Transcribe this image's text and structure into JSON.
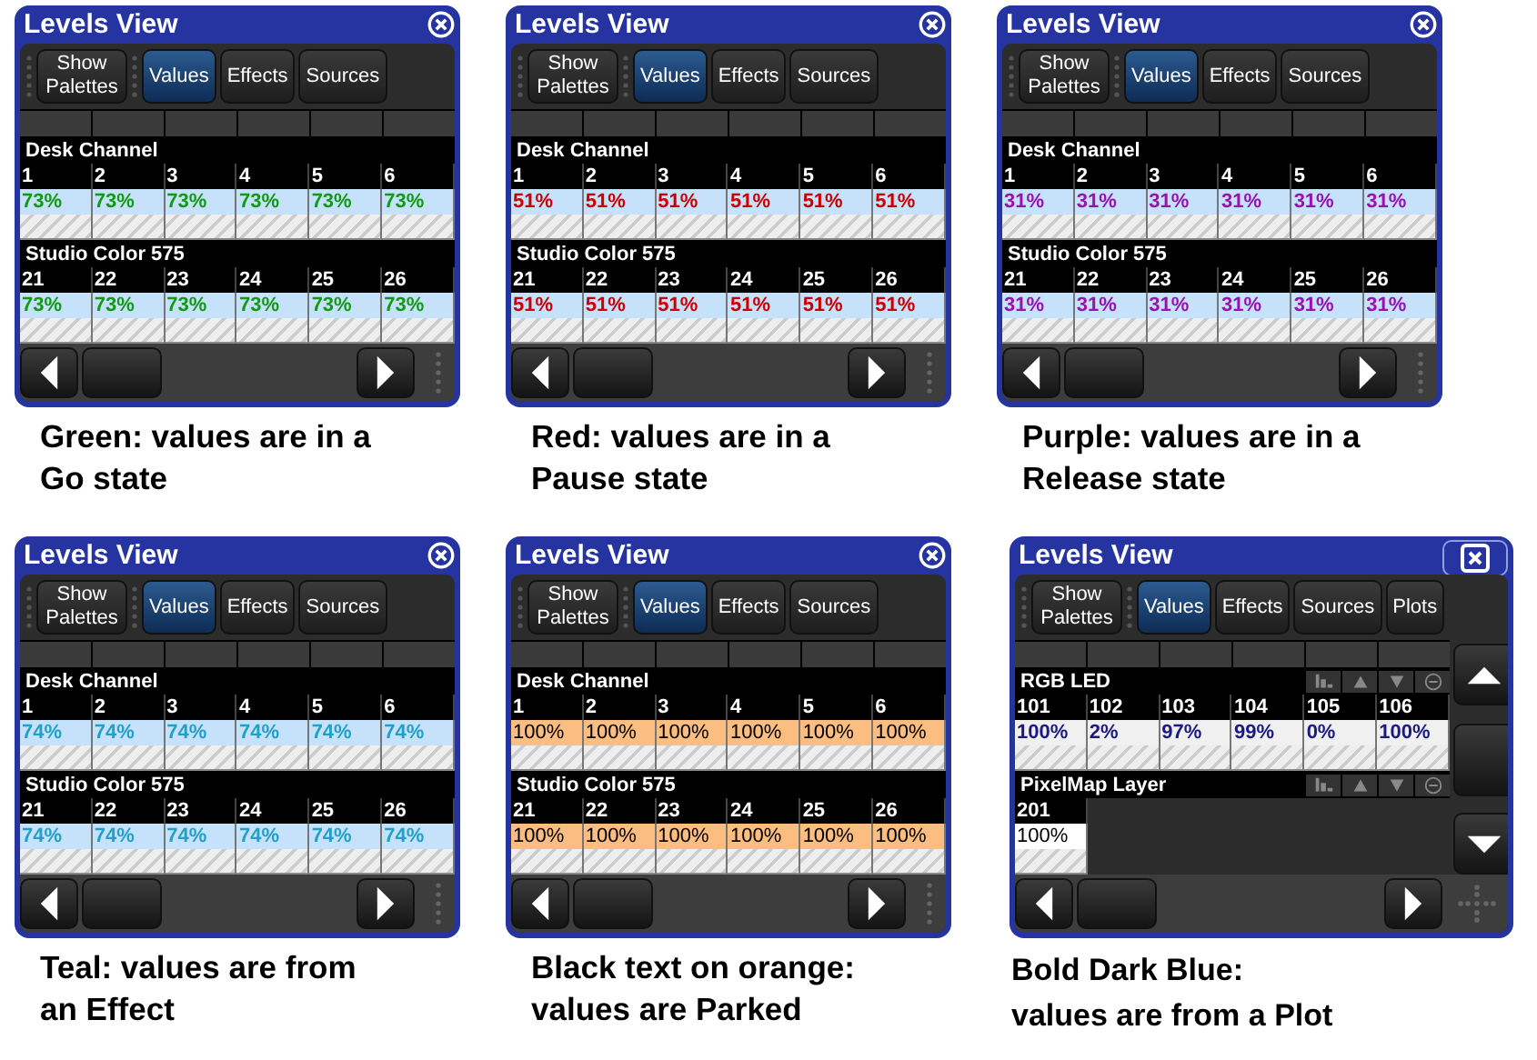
{
  "panels": [
    {
      "title": "Levels View",
      "kind": "standard",
      "tabs": [
        {
          "label": "Show Palettes",
          "selected": false
        },
        {
          "label": "Values",
          "selected": true
        },
        {
          "label": "Effects",
          "selected": false
        },
        {
          "label": "Sources",
          "selected": false
        }
      ],
      "groups": [
        {
          "name": "Desk Channel",
          "kind": "go",
          "channels": [
            {
              "number": "1",
              "value": "73%"
            },
            {
              "number": "2",
              "value": "73%"
            },
            {
              "number": "3",
              "value": "73%"
            },
            {
              "number": "4",
              "value": "73%"
            },
            {
              "number": "5",
              "value": "73%"
            },
            {
              "number": "6",
              "value": "73%"
            }
          ]
        },
        {
          "name": "Studio Color 575",
          "kind": "go",
          "channels": [
            {
              "number": "21",
              "value": "73%"
            },
            {
              "number": "22",
              "value": "73%"
            },
            {
              "number": "23",
              "value": "73%"
            },
            {
              "number": "24",
              "value": "73%"
            },
            {
              "number": "25",
              "value": "73%"
            },
            {
              "number": "26",
              "value": "73%"
            }
          ]
        }
      ],
      "caption": [
        "Green: values are in a",
        "Go state"
      ]
    },
    {
      "title": "Levels View",
      "kind": "standard",
      "tabs": [
        {
          "label": "Show Palettes",
          "selected": false
        },
        {
          "label": "Values",
          "selected": true
        },
        {
          "label": "Effects",
          "selected": false
        },
        {
          "label": "Sources",
          "selected": false
        }
      ],
      "groups": [
        {
          "name": "Desk Channel",
          "kind": "pause",
          "channels": [
            {
              "number": "1",
              "value": "51%"
            },
            {
              "number": "2",
              "value": "51%"
            },
            {
              "number": "3",
              "value": "51%"
            },
            {
              "number": "4",
              "value": "51%"
            },
            {
              "number": "5",
              "value": "51%"
            },
            {
              "number": "6",
              "value": "51%"
            }
          ]
        },
        {
          "name": "Studio Color 575",
          "kind": "pause",
          "channels": [
            {
              "number": "21",
              "value": "51%"
            },
            {
              "number": "22",
              "value": "51%"
            },
            {
              "number": "23",
              "value": "51%"
            },
            {
              "number": "24",
              "value": "51%"
            },
            {
              "number": "25",
              "value": "51%"
            },
            {
              "number": "26",
              "value": "51%"
            }
          ]
        }
      ],
      "caption": [
        "Red: values are in a",
        "Pause state"
      ]
    },
    {
      "title": "Levels View",
      "kind": "standard",
      "tabs": [
        {
          "label": "Show Palettes",
          "selected": false
        },
        {
          "label": "Values",
          "selected": true
        },
        {
          "label": "Effects",
          "selected": false
        },
        {
          "label": "Sources",
          "selected": false
        }
      ],
      "groups": [
        {
          "name": "Desk Channel",
          "kind": "release",
          "channels": [
            {
              "number": "1",
              "value": "31%"
            },
            {
              "number": "2",
              "value": "31%"
            },
            {
              "number": "3",
              "value": "31%"
            },
            {
              "number": "4",
              "value": "31%"
            },
            {
              "number": "5",
              "value": "31%"
            },
            {
              "number": "6",
              "value": "31%"
            }
          ]
        },
        {
          "name": "Studio Color 575",
          "kind": "release",
          "channels": [
            {
              "number": "21",
              "value": "31%"
            },
            {
              "number": "22",
              "value": "31%"
            },
            {
              "number": "23",
              "value": "31%"
            },
            {
              "number": "24",
              "value": "31%"
            },
            {
              "number": "25",
              "value": "31%"
            },
            {
              "number": "26",
              "value": "31%"
            }
          ]
        }
      ],
      "caption": [
        "Purple: values are in a",
        "Release state"
      ]
    },
    {
      "title": "Levels View",
      "kind": "standard",
      "tabs": [
        {
          "label": "Show Palettes",
          "selected": false
        },
        {
          "label": "Values",
          "selected": true
        },
        {
          "label": "Effects",
          "selected": false
        },
        {
          "label": "Sources",
          "selected": false
        }
      ],
      "groups": [
        {
          "name": "Desk Channel",
          "kind": "effect",
          "channels": [
            {
              "number": "1",
              "value": "74%"
            },
            {
              "number": "2",
              "value": "74%"
            },
            {
              "number": "3",
              "value": "74%"
            },
            {
              "number": "4",
              "value": "74%"
            },
            {
              "number": "5",
              "value": "74%"
            },
            {
              "number": "6",
              "value": "74%"
            }
          ]
        },
        {
          "name": "Studio Color 575",
          "kind": "effect",
          "channels": [
            {
              "number": "21",
              "value": "74%"
            },
            {
              "number": "22",
              "value": "74%"
            },
            {
              "number": "23",
              "value": "74%"
            },
            {
              "number": "24",
              "value": "74%"
            },
            {
              "number": "25",
              "value": "74%"
            },
            {
              "number": "26",
              "value": "74%"
            }
          ]
        }
      ],
      "caption": [
        "Teal: values are from",
        "an Effect"
      ]
    },
    {
      "title": "Levels View",
      "kind": "standard",
      "tabs": [
        {
          "label": "Show Palettes",
          "selected": false
        },
        {
          "label": "Values",
          "selected": true
        },
        {
          "label": "Effects",
          "selected": false
        },
        {
          "label": "Sources",
          "selected": false
        }
      ],
      "groups": [
        {
          "name": "Desk Channel",
          "kind": "parked",
          "channels": [
            {
              "number": "1",
              "value": "100%"
            },
            {
              "number": "2",
              "value": "100%"
            },
            {
              "number": "3",
              "value": "100%"
            },
            {
              "number": "4",
              "value": "100%"
            },
            {
              "number": "5",
              "value": "100%"
            },
            {
              "number": "6",
              "value": "100%"
            }
          ]
        },
        {
          "name": "Studio Color 575",
          "kind": "parked",
          "channels": [
            {
              "number": "21",
              "value": "100%"
            },
            {
              "number": "22",
              "value": "100%"
            },
            {
              "number": "23",
              "value": "100%"
            },
            {
              "number": "24",
              "value": "100%"
            },
            {
              "number": "25",
              "value": "100%"
            },
            {
              "number": "26",
              "value": "100%"
            }
          ]
        }
      ],
      "caption": [
        "Black text on orange:",
        "values are Parked"
      ]
    },
    {
      "title": "Levels View",
      "kind": "plot",
      "tabs": [
        {
          "label": "Show Palettes",
          "selected": false
        },
        {
          "label": "Values",
          "selected": true
        },
        {
          "label": "Effects",
          "selected": false
        },
        {
          "label": "Sources",
          "selected": false
        },
        {
          "label": "Plots",
          "selected": false
        }
      ],
      "groups": [
        {
          "name": "RGB LED",
          "kind": "plot",
          "channels": [
            {
              "number": "101",
              "value": "100%"
            },
            {
              "number": "102",
              "value": "2%"
            },
            {
              "number": "103",
              "value": "97%"
            },
            {
              "number": "104",
              "value": "99%"
            },
            {
              "number": "105",
              "value": "0%"
            },
            {
              "number": "106",
              "value": "100%"
            }
          ]
        },
        {
          "name": "PixelMap Layer",
          "kind": "plain",
          "channels": [
            {
              "number": "201",
              "value": "100%"
            }
          ]
        }
      ],
      "caption": [
        "Bold Dark Blue:",
        "values are from a Plot"
      ]
    }
  ]
}
